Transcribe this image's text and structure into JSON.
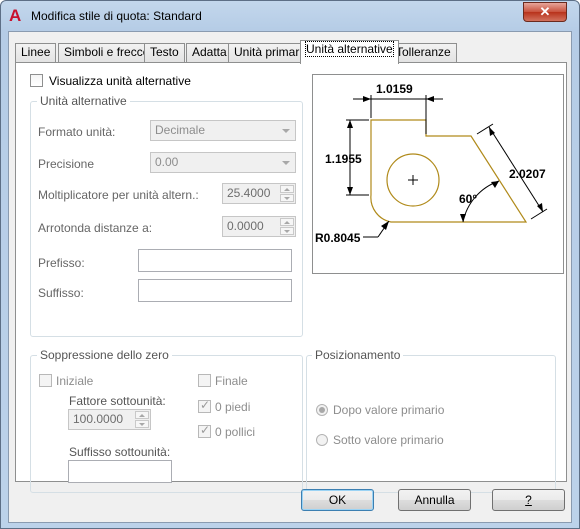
{
  "window": {
    "title": "Modifica stile di quota: Standard",
    "close_label": "✕"
  },
  "tabs": [
    {
      "label": "Linee"
    },
    {
      "label": "Simboli e frecce"
    },
    {
      "label": "Testo"
    },
    {
      "label": "Adatta"
    },
    {
      "label": "Unità primarie"
    },
    {
      "label": "Unità alternative"
    },
    {
      "label": "Tolleranze"
    }
  ],
  "active_tab": "Unità alternative",
  "show_alt_units": {
    "label": "Visualizza unità alternative",
    "checked": false
  },
  "alt_units": {
    "title": "Unità alternative",
    "unit_format_label": "Formato unità:",
    "unit_format_value": "Decimale",
    "precision_label": "Precisione",
    "precision_value": "0.00",
    "multiplier_label": "Moltiplicatore per unità altern.:",
    "multiplier_value": "25.4000",
    "round_label": "Arrotonda distanze a:",
    "round_value": "0.0000",
    "prefix_label": "Prefisso:",
    "prefix_value": "",
    "suffix_label": "Suffisso:",
    "suffix_value": ""
  },
  "zero_suppression": {
    "title": "Soppressione dello zero",
    "leading_label": "Iniziale",
    "leading_checked": false,
    "sub_factor_label": "Fattore sottounità:",
    "sub_factor_value": "100.0000",
    "sub_suffix_label": "Suffisso sottounità:",
    "sub_suffix_value": "",
    "trailing_label": "Finale",
    "trailing_checked": false,
    "zero_feet_label": "0 piedi",
    "zero_feet_checked": true,
    "zero_inches_label": "0 pollici",
    "zero_inches_checked": true
  },
  "placement": {
    "title": "Posizionamento",
    "after_primary_label": "Dopo valore primario",
    "below_primary_label": "Sotto valore primario",
    "selected": "after"
  },
  "preview": {
    "dim_top": "1.0159",
    "dim_left": "1.1955",
    "dim_right": "2.0207",
    "dim_angle": "60°",
    "dim_radius": "R0.8045"
  },
  "buttons": {
    "ok": "OK",
    "cancel": "Annulla",
    "help": "?"
  },
  "colors": {
    "shape": "#b08a1a",
    "accent": "#3c7fb1",
    "disabled_text": "#8d8d8d"
  }
}
